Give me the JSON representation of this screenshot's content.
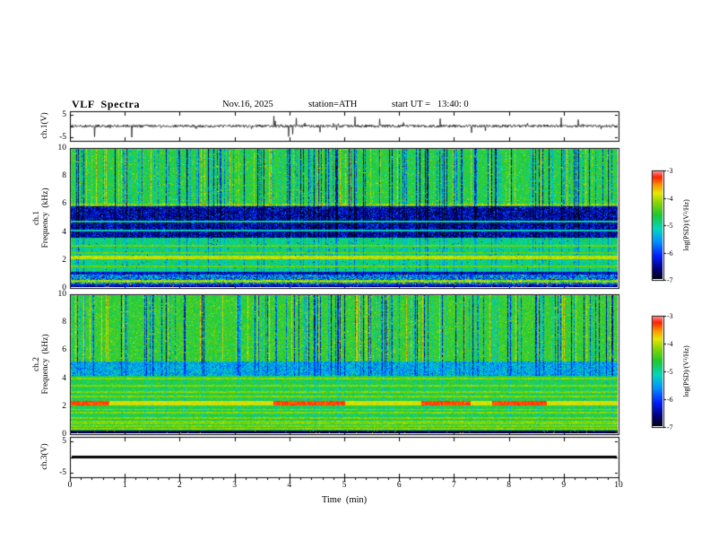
{
  "header": {
    "title": "VLF  Spectra",
    "date": "Nov.16, 2025",
    "station": "station=ATH",
    "start_ut": "start UT =   13:40: 0"
  },
  "left_labels": {
    "ch1_wave": "ch.1(V)",
    "ch1_spec_line1": "ch.1",
    "ch1_spec_line2": "Frequency  (kHz)",
    "ch2_spec_line1": "ch.2",
    "ch2_spec_line2": "Frequency  (kHz)",
    "ch3_wave": "ch.3(V)"
  },
  "axes": {
    "wave_yticks": [
      "5",
      "-5"
    ],
    "spec_yticks": [
      "10",
      "8",
      "6",
      "4",
      "2",
      "0"
    ],
    "x_ticks": [
      "0",
      "1",
      "2",
      "3",
      "4",
      "5",
      "6",
      "7",
      "8",
      "9",
      "10"
    ],
    "x_label": "Time  (min)"
  },
  "colorbar": {
    "ticks": [
      "-3",
      "-4",
      "-5",
      "-6",
      "-7"
    ],
    "label": "log(PSD)/(V²/Hz)",
    "colormap_stops": [
      [
        0.0,
        "#000010"
      ],
      [
        0.1,
        "#000080"
      ],
      [
        0.22,
        "#0020ff"
      ],
      [
        0.35,
        "#0090ff"
      ],
      [
        0.47,
        "#00d8c0"
      ],
      [
        0.6,
        "#20c830"
      ],
      [
        0.72,
        "#90d800"
      ],
      [
        0.8,
        "#e8e800"
      ],
      [
        0.88,
        "#ff9000"
      ],
      [
        0.95,
        "#ff2000"
      ],
      [
        1.0,
        "#ff8080"
      ]
    ]
  },
  "chart_data": [
    {
      "type": "line",
      "name": "ch1-voltage-waveform",
      "title": "ch.1(V)",
      "xlim": [
        0,
        10
      ],
      "x_unit": "min",
      "ylim": [
        -5,
        5
      ],
      "description": "Broadband noise trace centered on 0 V with dense impulsive spikes; typical amplitude about ±0.5 V with frequent spikes reaching toward ±5 V across the whole 0–10 min record."
    },
    {
      "type": "heatmap",
      "name": "ch1-spectrogram",
      "title": "ch.1 Frequency (kHz)",
      "xlim": [
        0,
        10
      ],
      "ylim": [
        0,
        10
      ],
      "zlim": [
        -7,
        -3
      ],
      "zlabel": "log(PSD)/(V²/Hz)",
      "background_level": -4.65,
      "features": {
        "dark_band_khz": [
          3.6,
          5.9
        ],
        "dark_line_khz": 1.05,
        "cyan_lines_khz": [
          4.75,
          4.1
        ],
        "bright_lines_khz": [
          3.0,
          2.5,
          2.15,
          1.55
        ],
        "strongest_line_khz": 2.15,
        "low_band_khz": [
          0,
          0.95
        ],
        "streak_zone_khz": [
          5.9,
          10
        ],
        "streak_description": "frequent vertical blue (low-PSD) impulsive streaks, strongest above 6 kHz, some crossing the full band"
      }
    },
    {
      "type": "heatmap",
      "name": "ch2-spectrogram",
      "title": "ch.2 Frequency (kHz)",
      "xlim": [
        0,
        10
      ],
      "ylim": [
        0,
        10
      ],
      "zlim": [
        -7,
        -3
      ],
      "zlabel": "log(PSD)/(V²/Hz)",
      "background_level": -4.55,
      "features": {
        "dark_band_khz": [
          4.2,
          5.2
        ],
        "strong_line_khz": 2.2,
        "red_segments_min": [
          [
            0,
            0.7
          ],
          [
            3.7,
            5.0
          ],
          [
            6.4,
            7.3
          ],
          [
            7.7,
            8.7
          ]
        ],
        "bright_lines_khz": [
          4.0,
          3.45,
          3.0,
          2.7,
          1.75,
          1.5,
          1.15,
          0.9,
          0.75,
          0.55,
          0.35
        ],
        "black_band_khz": [
          0,
          0.25
        ],
        "streak_zone_khz": [
          5.2,
          10
        ],
        "streak_description": "vertical blue impulsive streaks above ~5 kHz; strong yellow line near 2.2 kHz with red-brown high-PSD segments"
      }
    },
    {
      "type": "line",
      "name": "ch3-voltage-waveform",
      "title": "ch.3(V)",
      "xlim": [
        0,
        10
      ],
      "ylim": [
        -5,
        5
      ],
      "description": "Constant 0 V — flat thick black line across the entire record."
    }
  ]
}
